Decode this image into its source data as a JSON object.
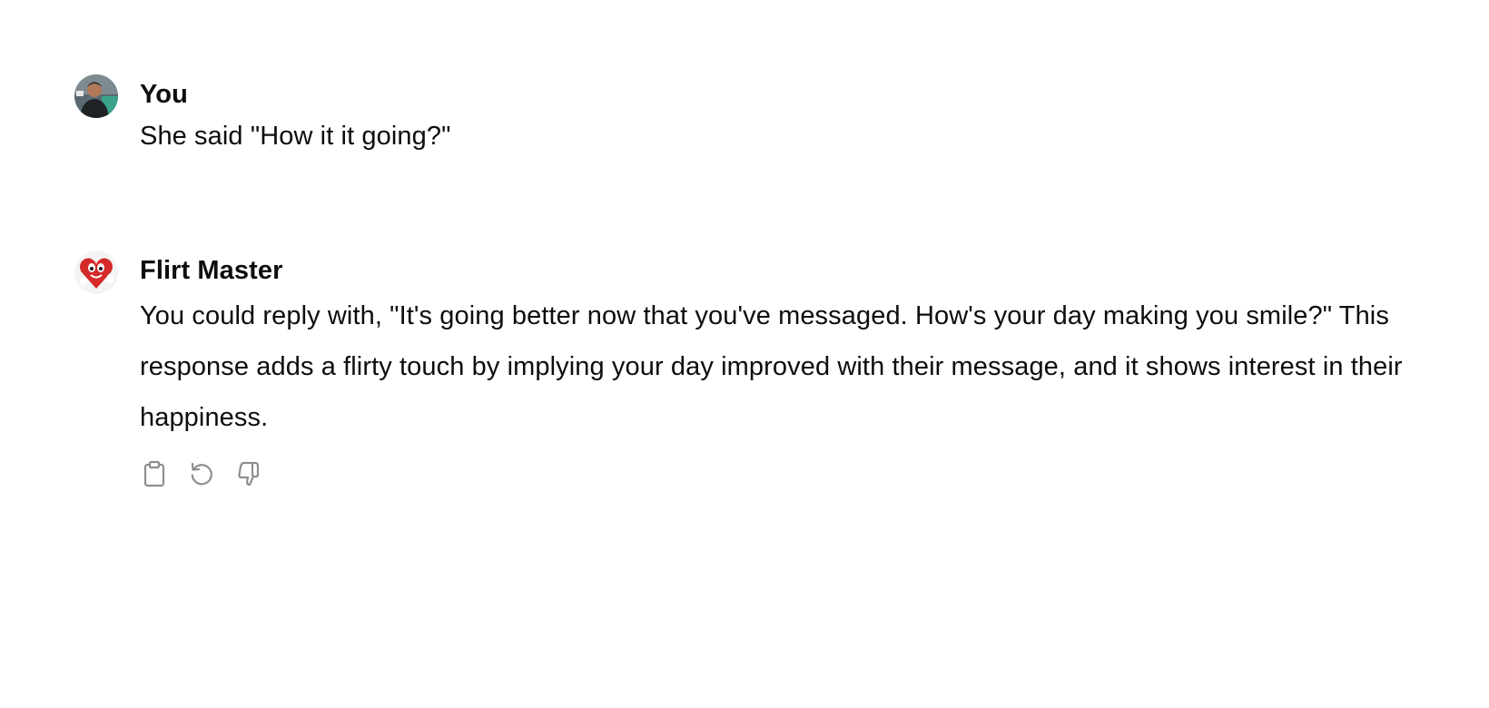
{
  "messages": [
    {
      "role": "user",
      "author": "You",
      "text": "She said \"How it it going?\""
    },
    {
      "role": "assistant",
      "author": "Flirt Master",
      "text": "You could reply with, \"It's going better now that you've messaged. How's your day making you smile?\" This response adds a flirty touch by implying your day improved with their message, and it shows interest in their happiness."
    }
  ],
  "actions": {
    "icons": [
      "clipboard-icon",
      "regenerate-icon",
      "thumbs-down-icon"
    ]
  },
  "colors": {
    "text": "#0d0d0d",
    "icon": "#8e8e8e",
    "background": "#ffffff"
  }
}
